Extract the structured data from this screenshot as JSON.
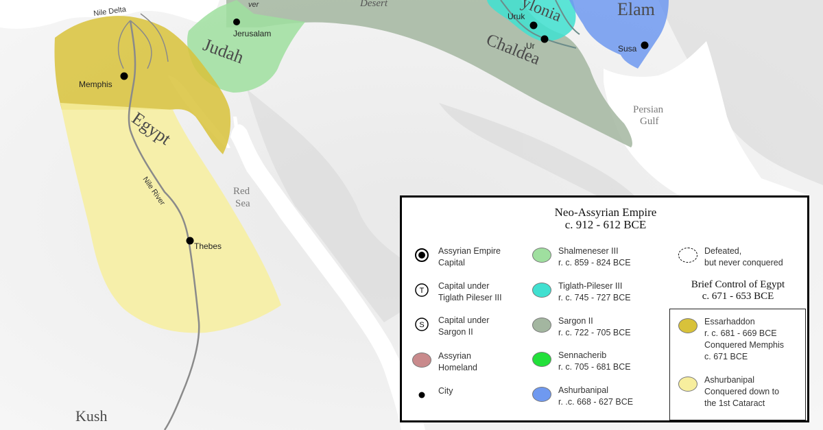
{
  "map": {
    "regions": {
      "judah": "Judah",
      "egypt": "Egypt",
      "chaldea": "Chaldea",
      "babylonia": "ylonia",
      "elam": "Elam",
      "kush": "Kush",
      "desert": "Desert"
    },
    "cities": {
      "jerusalem": "Jerusalam",
      "memphis": "Memphis",
      "thebes": "Thebes",
      "uruk": "Uruk",
      "ur": "Ur",
      "susa": "Susa"
    },
    "waters": {
      "red_sea_1": "Red",
      "red_sea_2": "Sea",
      "persian_gulf_1": "Persian",
      "persian_gulf_2": "Gulf",
      "nile_delta": "Nile Delta",
      "nile_river": "Nile River",
      "river_fragment": "ver"
    },
    "colors": {
      "shalmaneser": "#9fdf9f",
      "tiglath": "#40e0d0",
      "sargon": "#a3b6a0",
      "sennacherib": "#22e03a",
      "ashurbanipal": "#6f99f0",
      "homeland": "#c98a8c",
      "essarhaddon": "#d8c23a",
      "ashurbanipal_egypt": "#f7ee9e"
    }
  },
  "legend": {
    "title_1": "Neo-Assyrian Empire",
    "title_2": "c. 912 - 612 BCE",
    "col1": [
      {
        "icon": "capital-icon",
        "line1": "Assyrian Empire",
        "line2": "Capital"
      },
      {
        "icon": "t-capital-icon",
        "symbol": "T",
        "line1": "Capital under",
        "line2": "Tiglath Pileser III"
      },
      {
        "icon": "s-capital-icon",
        "symbol": "S",
        "line1": "Capital under",
        "line2": "Sargon II"
      },
      {
        "icon": "homeland-swatch",
        "line1": "Assyrian",
        "line2": "Homeland"
      },
      {
        "icon": "city-icon",
        "line1": "City",
        "line2": ""
      }
    ],
    "col2": [
      {
        "line1": "Shalmeneser III",
        "line2": "r. c. 859 - 824 BCE"
      },
      {
        "line1": "Tiglath-Pileser III",
        "line2": "r. c. 745 - 727 BCE"
      },
      {
        "line1": "Sargon II",
        "line2": "r. c. 722 - 705 BCE"
      },
      {
        "line1": "Sennacherib",
        "line2": "r. c. 705 - 681 BCE"
      },
      {
        "line1": "Ashurbanipal",
        "line2": "r. .c. 668 - 627 BCE"
      }
    ],
    "col3": {
      "defeated_1": "Defeated,",
      "defeated_2": "but never conquered",
      "sub_title_1": "Brief Control of Egypt",
      "sub_title_2": "c. 671 - 653 BCE",
      "essarhaddon": [
        "Essarhaddon",
        "r. c. 681 - 669 BCE",
        "Conquered Memphis",
        "c. 671 BCE"
      ],
      "ashurbanipal": [
        "Ashurbanipal",
        "Conquered down to",
        "the 1st Cataract"
      ]
    }
  }
}
